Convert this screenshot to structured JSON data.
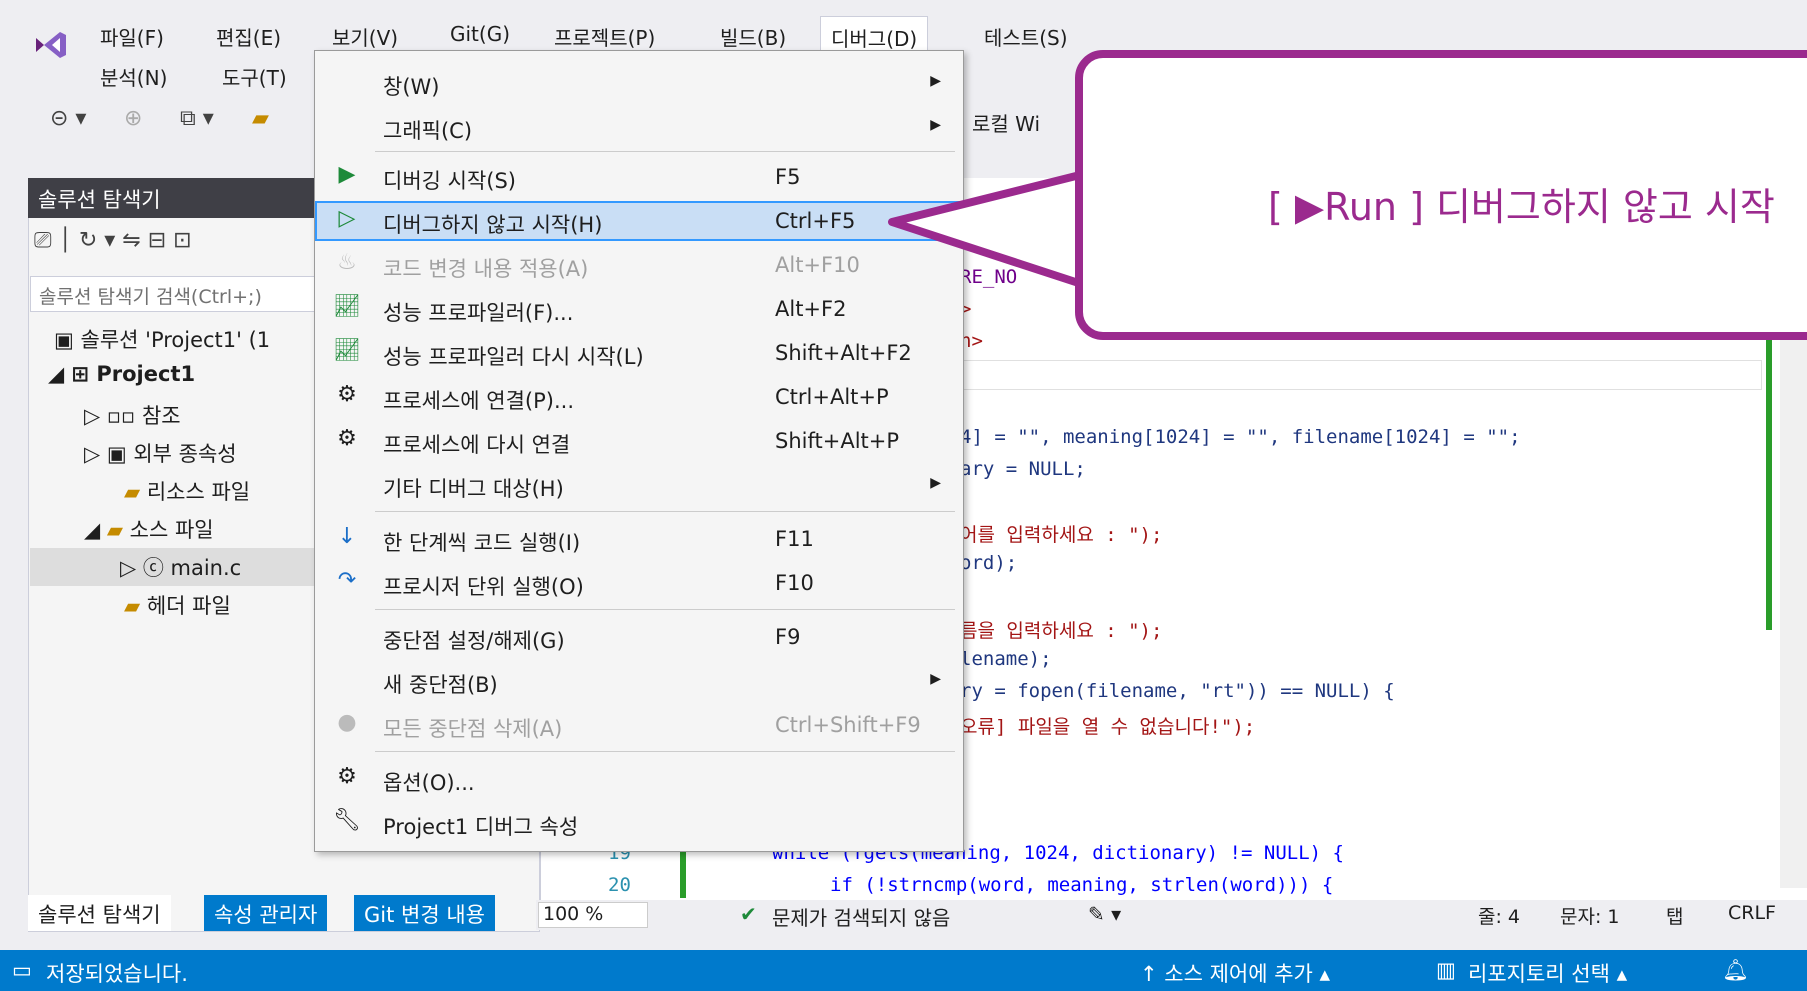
{
  "menubar": {
    "items": [
      "파일(F)",
      "편집(E)",
      "보기(V)",
      "Git(G)",
      "프로젝트(P)",
      "빌드(B)",
      "디버그(D)",
      "테스트(S)"
    ],
    "row2": [
      "분석(N)",
      "도구(T)"
    ],
    "project_badge": "Project1",
    "local_target": "로컬 Wi"
  },
  "solution_explorer": {
    "title": "솔루션 탐색기",
    "search_placeholder": "솔루션 탐색기 검색(Ctrl+;)",
    "tree": [
      "솔루션 'Project1' (1",
      "Project1",
      "참조",
      "외부 종속성",
      "리소스 파일",
      "소스 파일",
      "main.c",
      "헤더 파일"
    ]
  },
  "debug_menu": {
    "items": [
      {
        "label": "창(W)",
        "shortcut": "",
        "submenu": true
      },
      {
        "label": "그래픽(C)",
        "shortcut": "",
        "submenu": true
      },
      {
        "label": "디버깅 시작(S)",
        "shortcut": "F5"
      },
      {
        "label": "디버그하지 않고 시작(H)",
        "shortcut": "Ctrl+F5"
      },
      {
        "label": "코드 변경 내용 적용(A)",
        "shortcut": "Alt+F10"
      },
      {
        "label": "성능 프로파일러(F)...",
        "shortcut": "Alt+F2"
      },
      {
        "label": "성능 프로파일러 다시 시작(L)",
        "shortcut": "Shift+Alt+F2"
      },
      {
        "label": "프로세스에 연결(P)...",
        "shortcut": "Ctrl+Alt+P"
      },
      {
        "label": "프로세스에 다시 연결",
        "shortcut": "Shift+Alt+P"
      },
      {
        "label": "기타 디버그 대상(H)",
        "shortcut": "",
        "submenu": true
      },
      {
        "label": "한 단계씩 코드 실행(I)",
        "shortcut": "F11"
      },
      {
        "label": "프로시저 단위 실행(O)",
        "shortcut": "F10"
      },
      {
        "label": "중단점 설정/해제(G)",
        "shortcut": "F9"
      },
      {
        "label": "새 중단점(B)",
        "shortcut": "",
        "submenu": true
      },
      {
        "label": "모든 중단점 삭제(A)",
        "shortcut": "Ctrl+Shift+F9"
      },
      {
        "label": "옵션(O)...",
        "shortcut": ""
      },
      {
        "label": "Project1 디버그 속성",
        "shortcut": ""
      }
    ]
  },
  "callout": {
    "text": "[ ▶Run ] 디버그하지 않고 시작"
  },
  "editor": {
    "frag1": "RE_NO",
    "frag2": ">",
    "frag3": "n>",
    "line_words": "4] = \"\", meaning[1024] = \"\", filename[1024] = \"\";",
    "line_dict": "ary = NULL;",
    "line_prompt1": "어를 입력하세요 : \");",
    "line_word": "ord);",
    "line_prompt2": "름을 입력하세요 : \");",
    "line_filename": "lename);",
    "line_fopen": "ry = fopen(filename, \"rt\")) == NULL) {",
    "line_error": "오류] 파일을 열 수 없습니다!\");",
    "line19_num": "19",
    "line19": "while (fgets(meaning, 1024, dictionary) != NULL) {",
    "line20_num": "20",
    "line20": "if (!strncmp(word, meaning, strlen(word))) {"
  },
  "editor_status": {
    "zoom": "100 %",
    "issues": "문제가 검색되지 않음",
    "line": "줄: 4",
    "col": "문자: 1",
    "tab": "탭",
    "eol": "CRLF"
  },
  "bottom_tabs": [
    "솔루션 탐색기",
    "속성 관리자",
    "Git 변경 내용"
  ],
  "statusbar": {
    "saved": "저장되었습니다.",
    "source_control": "↑ 소스 제어에 추가 ▴",
    "repo": "리포지토리 선택 ▴"
  }
}
